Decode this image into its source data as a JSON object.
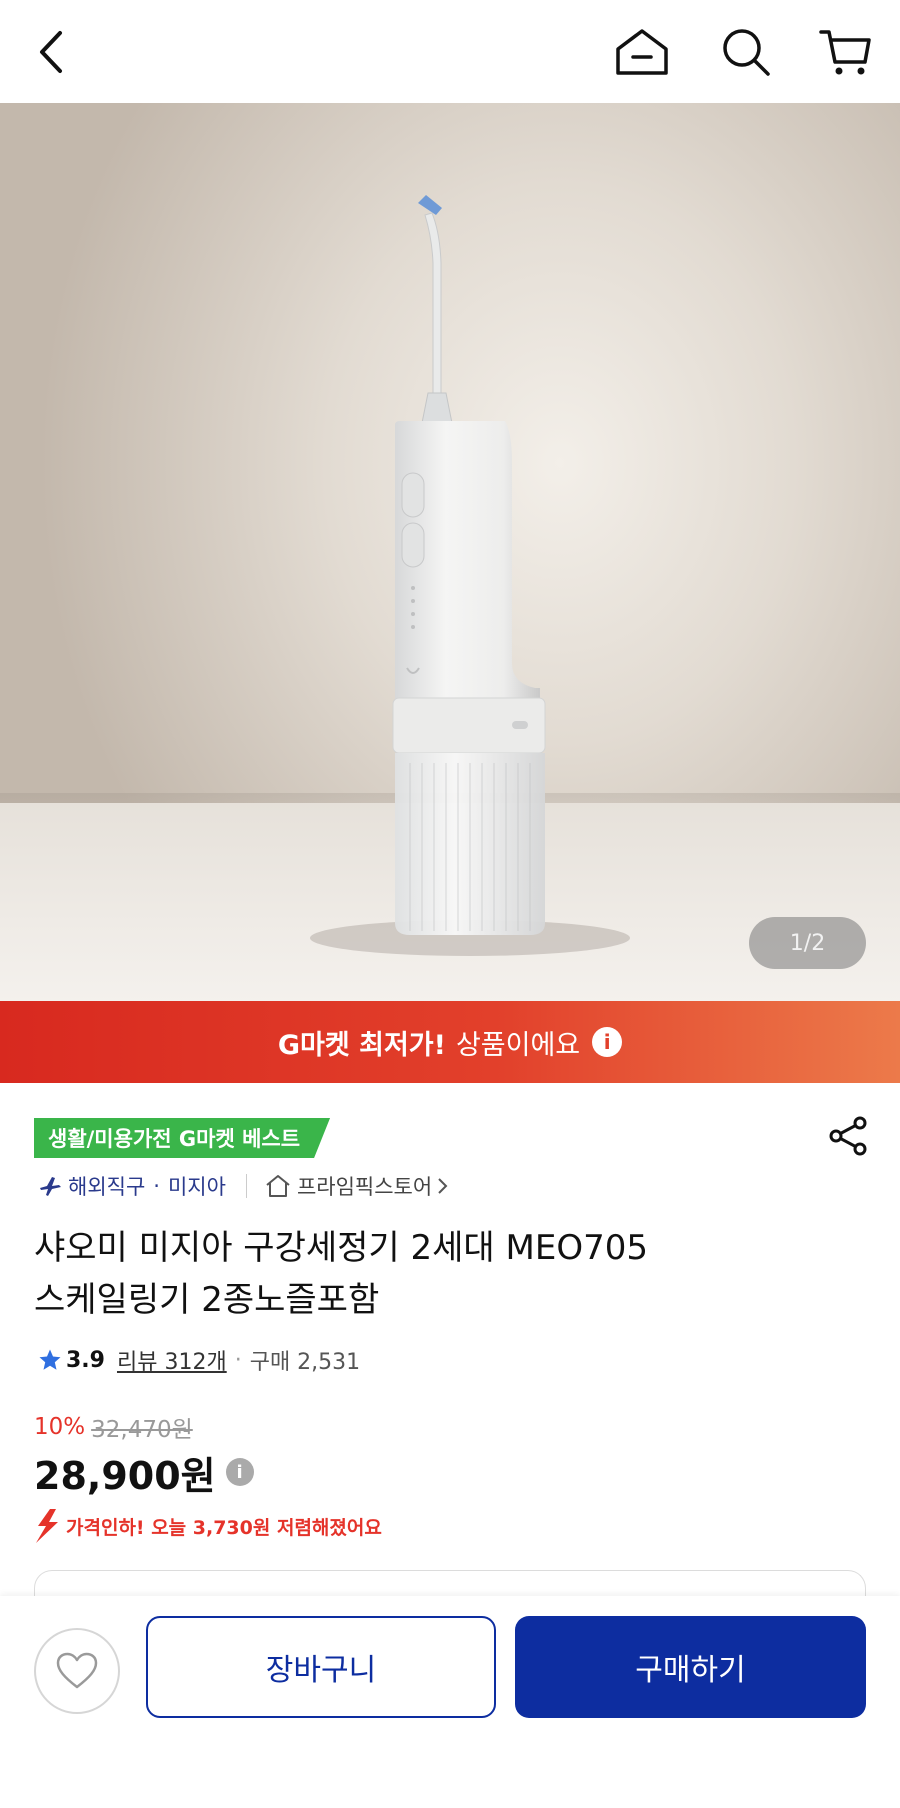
{
  "header": {
    "back_icon": "chevron-left-icon",
    "home_icon": "home-icon",
    "search_icon": "search-icon",
    "cart_icon": "cart-icon"
  },
  "gallery": {
    "pager": "1/2"
  },
  "banner": {
    "strong_text": "G마켓 최저가!",
    "text": "상품이에요",
    "info_glyph": "i"
  },
  "product": {
    "best_badge": "생활/미용가전 G마켓 베스트",
    "shipping_type": "해외직구",
    "brand": "미지아",
    "store": "프라임픽스토어",
    "title_line1": "샤오미 미지아 구강세정기 2세대 MEO705",
    "title_line2": "스케일링기 2종노즐포함",
    "rating": "3.9",
    "reviews": "리뷰 312개",
    "purchases": "구매 2,531",
    "discount_rate": "10%",
    "original_price": "32,470원",
    "price": "28,900원",
    "price_drop": "가격인하! 오늘 3,730원 저렴해졌어요"
  },
  "bottom": {
    "cart_button": "장바구니",
    "buy_button": "구매하기"
  },
  "colors": {
    "primary": "#0d2da0",
    "banner_start": "#d8291f",
    "banner_end": "#ec7a4a",
    "best_badge": "#3ab54a",
    "discount": "#e5332a",
    "star": "#2f6fe0"
  }
}
